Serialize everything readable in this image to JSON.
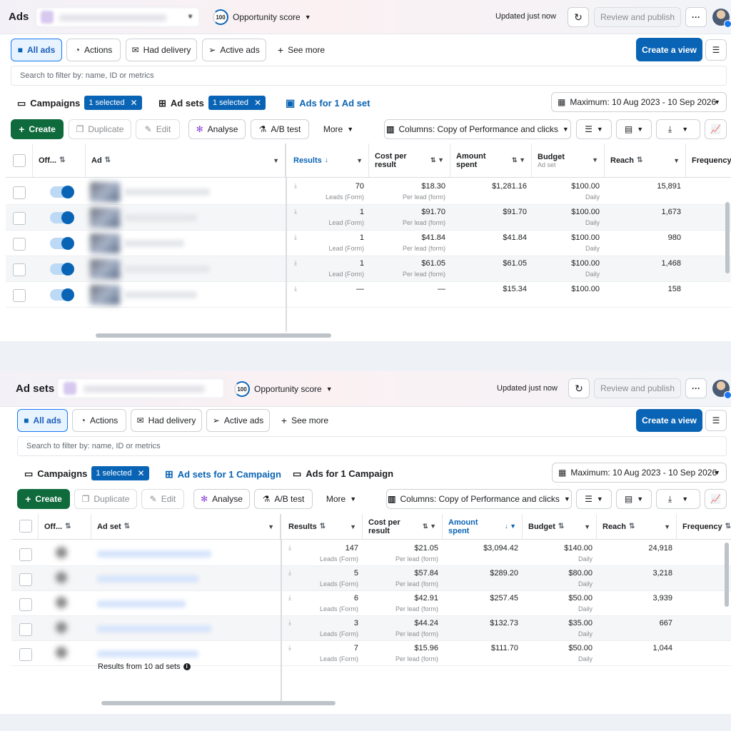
{
  "common": {
    "opportunity_score_value": "100",
    "opportunity_score_label": "Opportunity score",
    "updated_text": "Updated just now",
    "review_publish_label": "Review and publish",
    "more_menu_label": "···",
    "filter_tabs": [
      "All ads",
      "Actions",
      "Had delivery",
      "Active ads"
    ],
    "see_more_label": "See more",
    "create_view_label": "Create a view",
    "search_placeholder": "Search to filter by: name, ID or metrics",
    "date_range": "Maximum: 10 Aug 2023 - 10 Sep 2026",
    "campaigns_label": "Campaigns",
    "selected_label": "1 selected",
    "toolbar": {
      "create": "Create",
      "duplicate": "Duplicate",
      "edit": "Edit",
      "analyse": "Analyse",
      "ab_test": "A/B test",
      "more": "More",
      "columns": "Columns: Copy of Performance and clicks"
    },
    "accent_color": "#0a64b5",
    "create_button_color": "#106b3c"
  },
  "ads_panel": {
    "title": "Ads",
    "ad_sets_label": "Ad sets",
    "active_tab_label": "Ads for 1 Ad set",
    "columns": {
      "off_on": "Off...",
      "name": "Ad",
      "results": "Results",
      "cost_per_result_1": "Cost per",
      "cost_per_result_2": "result",
      "amount_spent_1": "Amount",
      "amount_spent_2": "spent",
      "budget": "Budget",
      "budget_sub": "Ad set",
      "reach": "Reach",
      "frequency": "Frequency"
    },
    "rows": [
      {
        "results": "70",
        "results_sub": "Leads (Form)",
        "cost": "$18.30",
        "cost_sub": "Per lead (form)",
        "spent": "$1,281.16",
        "budget": "$100.00",
        "budget_sub": "Daily",
        "reach": "15,891"
      },
      {
        "results": "1",
        "results_sub": "Lead (Form)",
        "cost": "$91.70",
        "cost_sub": "Per lead (form)",
        "spent": "$91.70",
        "budget": "$100.00",
        "budget_sub": "Daily",
        "reach": "1,673"
      },
      {
        "results": "1",
        "results_sub": "Lead (Form)",
        "cost": "$41.84",
        "cost_sub": "Per lead (form)",
        "spent": "$41.84",
        "budget": "$100.00",
        "budget_sub": "Daily",
        "reach": "980"
      },
      {
        "results": "1",
        "results_sub": "Lead (Form)",
        "cost": "$61.05",
        "cost_sub": "Per lead (form)",
        "spent": "$61.05",
        "budget": "$100.00",
        "budget_sub": "Daily",
        "reach": "1,468"
      },
      {
        "results": "—",
        "results_sub": "",
        "cost": "—",
        "cost_sub": "",
        "spent": "$15.34",
        "budget": "$100.00",
        "budget_sub": "",
        "reach": "158"
      }
    ]
  },
  "adsets_panel": {
    "title": "Ad sets",
    "active_tab_label": "Ad sets for 1 Campaign",
    "ads_tab_label": "Ads for 1 Campaign",
    "columns": {
      "off_on": "Off...",
      "name": "Ad set",
      "results": "Results",
      "cost_per_result_1": "Cost per",
      "cost_per_result_2": "result",
      "amount_spent_1": "Amount",
      "amount_spent_2": "spent",
      "budget": "Budget",
      "reach": "Reach",
      "frequency": "Frequency"
    },
    "rows": [
      {
        "results": "147",
        "results_sub": "Leads (Form)",
        "cost": "$21.05",
        "cost_sub": "Per lead (form)",
        "spent": "$3,094.42",
        "budget": "$140.00",
        "budget_sub": "Daily",
        "reach": "24,918"
      },
      {
        "results": "5",
        "results_sub": "Leads (Form)",
        "cost": "$57.84",
        "cost_sub": "Per lead (form)",
        "spent": "$289.20",
        "budget": "$80.00",
        "budget_sub": "Daily",
        "reach": "3,218"
      },
      {
        "results": "6",
        "results_sub": "Leads (Form)",
        "cost": "$42.91",
        "cost_sub": "Per lead (form)",
        "spent": "$257.45",
        "budget": "$50.00",
        "budget_sub": "Daily",
        "reach": "3,939"
      },
      {
        "results": "3",
        "results_sub": "Leads (Form)",
        "cost": "$44.24",
        "cost_sub": "Per lead (form)",
        "spent": "$132.73",
        "budget": "$35.00",
        "budget_sub": "Daily",
        "reach": "667"
      },
      {
        "results": "7",
        "results_sub": "Leads (Form)",
        "cost": "$15.96",
        "cost_sub": "Per lead (form)",
        "spent": "$111.70",
        "budget": "$50.00",
        "budget_sub": "Daily",
        "reach": "1,044"
      }
    ],
    "footer": "Results from 10 ad sets"
  }
}
